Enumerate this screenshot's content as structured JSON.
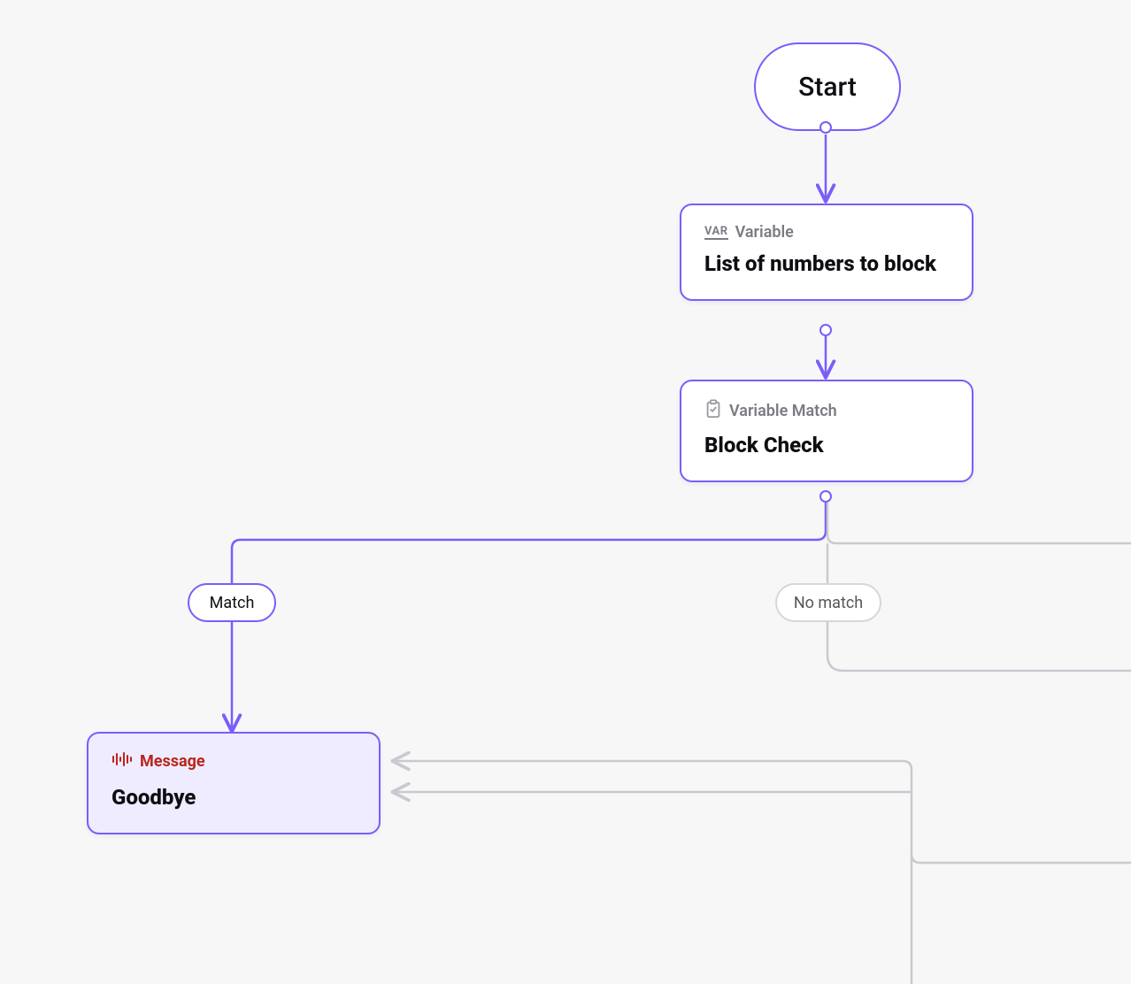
{
  "start": {
    "label": "Start"
  },
  "nodes": {
    "variable": {
      "type_label": "Variable",
      "title": "List of numbers to block"
    },
    "variable_match": {
      "type_label": "Variable Match",
      "title": "Block Check"
    },
    "message": {
      "type_label": "Message",
      "title": "Goodbye"
    }
  },
  "branches": {
    "match": "Match",
    "no_match": "No match"
  },
  "icons": {
    "var_badge": "VAR"
  }
}
